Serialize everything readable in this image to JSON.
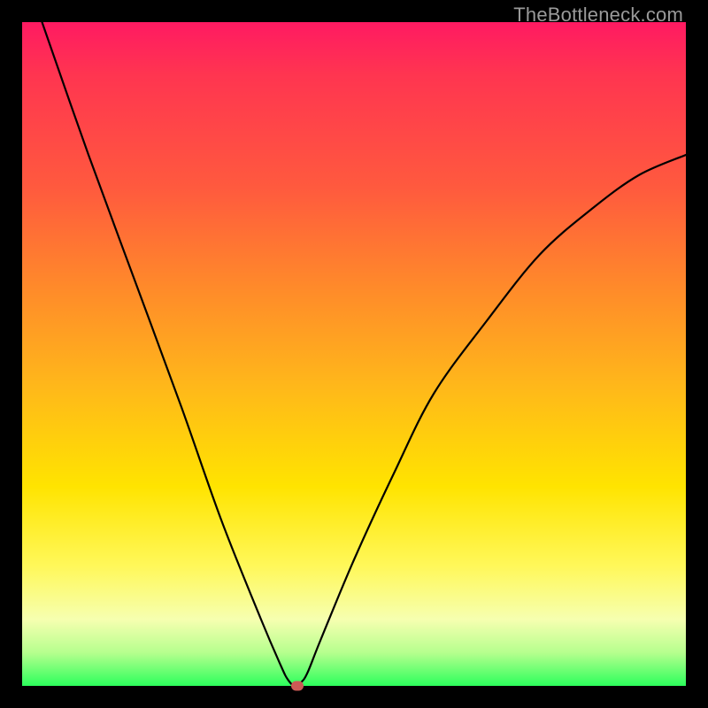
{
  "watermark": "TheBottleneck.com",
  "chart_data": {
    "type": "line",
    "title": "",
    "xlabel": "",
    "ylabel": "",
    "xlim": [
      0,
      100
    ],
    "ylim": [
      0,
      100
    ],
    "grid": false,
    "legend": false,
    "series": [
      {
        "name": "bottleneck-curve",
        "x": [
          3,
          10,
          17,
          24,
          30,
          36,
          39,
          40,
          41,
          42,
          43,
          45,
          50,
          56,
          62,
          70,
          78,
          86,
          93,
          100
        ],
        "values": [
          100,
          80,
          61,
          42,
          25,
          10,
          3,
          1,
          0,
          0.5,
          2,
          7,
          19,
          32,
          44,
          55,
          65,
          72,
          77,
          80
        ]
      }
    ],
    "annotations": [
      {
        "name": "minimum-marker",
        "x": 41.5,
        "y": 0,
        "color": "#cc5a55"
      }
    ],
    "background_gradient": {
      "direction": "vertical",
      "stops": [
        {
          "pos": 0,
          "color": "#ff1a62"
        },
        {
          "pos": 8,
          "color": "#ff3550"
        },
        {
          "pos": 25,
          "color": "#ff5a3e"
        },
        {
          "pos": 40,
          "color": "#ff8a2a"
        },
        {
          "pos": 55,
          "color": "#ffb81a"
        },
        {
          "pos": 70,
          "color": "#ffe400"
        },
        {
          "pos": 82,
          "color": "#fff85a"
        },
        {
          "pos": 90,
          "color": "#f6ffb0"
        },
        {
          "pos": 95,
          "color": "#b6ff8e"
        },
        {
          "pos": 100,
          "color": "#2cff5c"
        }
      ]
    }
  }
}
